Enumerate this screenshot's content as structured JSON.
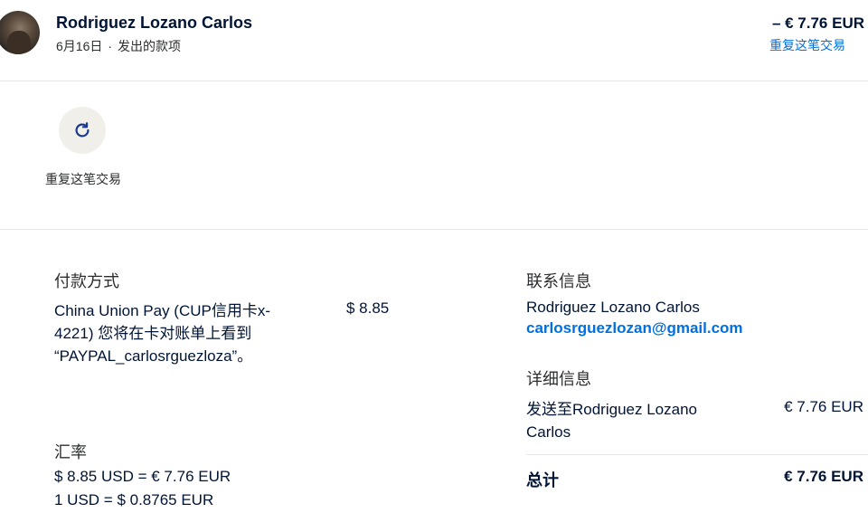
{
  "header": {
    "name": "Rodriguez Lozano Carlos",
    "date": "6月16日",
    "separator": "·",
    "type": "发出的款项",
    "amount": "– € 7.76 EUR",
    "repeat_link": "重复这笔交易"
  },
  "actions": {
    "repeat_label": "重复这笔交易",
    "repeat_icon": "refresh-icon"
  },
  "payment": {
    "title": "付款方式",
    "method": "China Union Pay (CUP信用卡x-4221) 您将在卡对账单上看到 “PAYPAL_carlosrguezloza”。",
    "amount": "$ 8.85"
  },
  "exchange": {
    "title": "汇率",
    "line1": "$ 8.85 USD = € 7.76 EUR",
    "line2": "1 USD = $ 0.8765 EUR"
  },
  "contact": {
    "title": "联系信息",
    "name": "Rodriguez Lozano Carlos",
    "email": "carlosrguezlozan@gmail.com"
  },
  "details": {
    "title": "详细信息",
    "sent_to": "发送至Rodriguez Lozano Carlos",
    "sent_amount": "€ 7.76 EUR",
    "total_label": "总计",
    "total_amount": "€ 7.76 EUR"
  },
  "colors": {
    "link": "#0070e0",
    "text": "#001435",
    "icon_bg": "#f1efea",
    "icon": "#1a3a8f"
  }
}
